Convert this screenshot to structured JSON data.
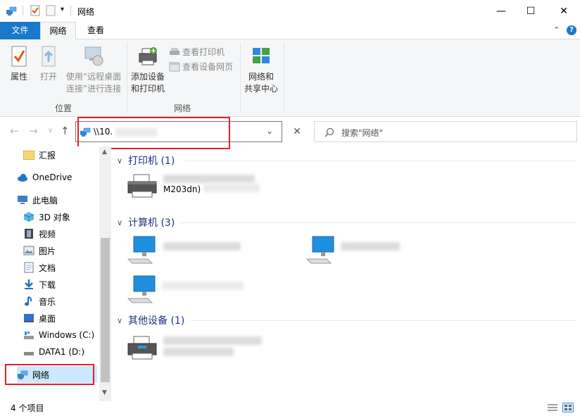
{
  "window": {
    "title": "网络",
    "minimize_glyph": "—",
    "maximize_glyph": "☐",
    "close_glyph": "✕"
  },
  "tabs": {
    "file": "文件",
    "network": "网络",
    "view": "查看"
  },
  "ribbon": {
    "properties": "属性",
    "open": "打开",
    "remote_desktop_line1": "使用“远程桌面",
    "remote_desktop_line2": "连接”进行连接",
    "group_location": "位置",
    "add_device_line1": "添加设备",
    "add_device_line2": "和打印机",
    "view_printers": "查看打印机",
    "view_devices_web": "查看设备网页",
    "group_network": "网络",
    "network_center_line1": "网络和",
    "network_center_line2": "共享中心"
  },
  "address": {
    "path": "\\\\10.",
    "search_placeholder": "搜索\"网络\""
  },
  "sidebar": {
    "items": [
      {
        "label": "汇报",
        "icon": "folder-icon"
      },
      {
        "label": "OneDrive",
        "icon": "cloud-icon"
      },
      {
        "label": "此电脑",
        "icon": "computer-icon"
      },
      {
        "label": "3D 对象",
        "icon": "cube-icon"
      },
      {
        "label": "视频",
        "icon": "film-icon"
      },
      {
        "label": "图片",
        "icon": "picture-icon"
      },
      {
        "label": "文档",
        "icon": "document-icon"
      },
      {
        "label": "下载",
        "icon": "download-icon"
      },
      {
        "label": "音乐",
        "icon": "music-icon"
      },
      {
        "label": "桌面",
        "icon": "desktop-icon"
      },
      {
        "label": "Windows (C:)",
        "icon": "drive-c-icon"
      },
      {
        "label": "DATA1 (D:)",
        "icon": "drive-d-icon"
      },
      {
        "label": "网络",
        "icon": "network-icon"
      }
    ]
  },
  "content": {
    "printers_header": "打印机 (1)",
    "printer_name_suffix": "M203dn)",
    "computers_header": "计算机 (3)",
    "other_header": "其他设备 (1)"
  },
  "status": {
    "item_count": "4 个项目"
  },
  "colors": {
    "accent": "#1979ca",
    "group_text": "#1e3287",
    "highlight": "#e0202a"
  }
}
